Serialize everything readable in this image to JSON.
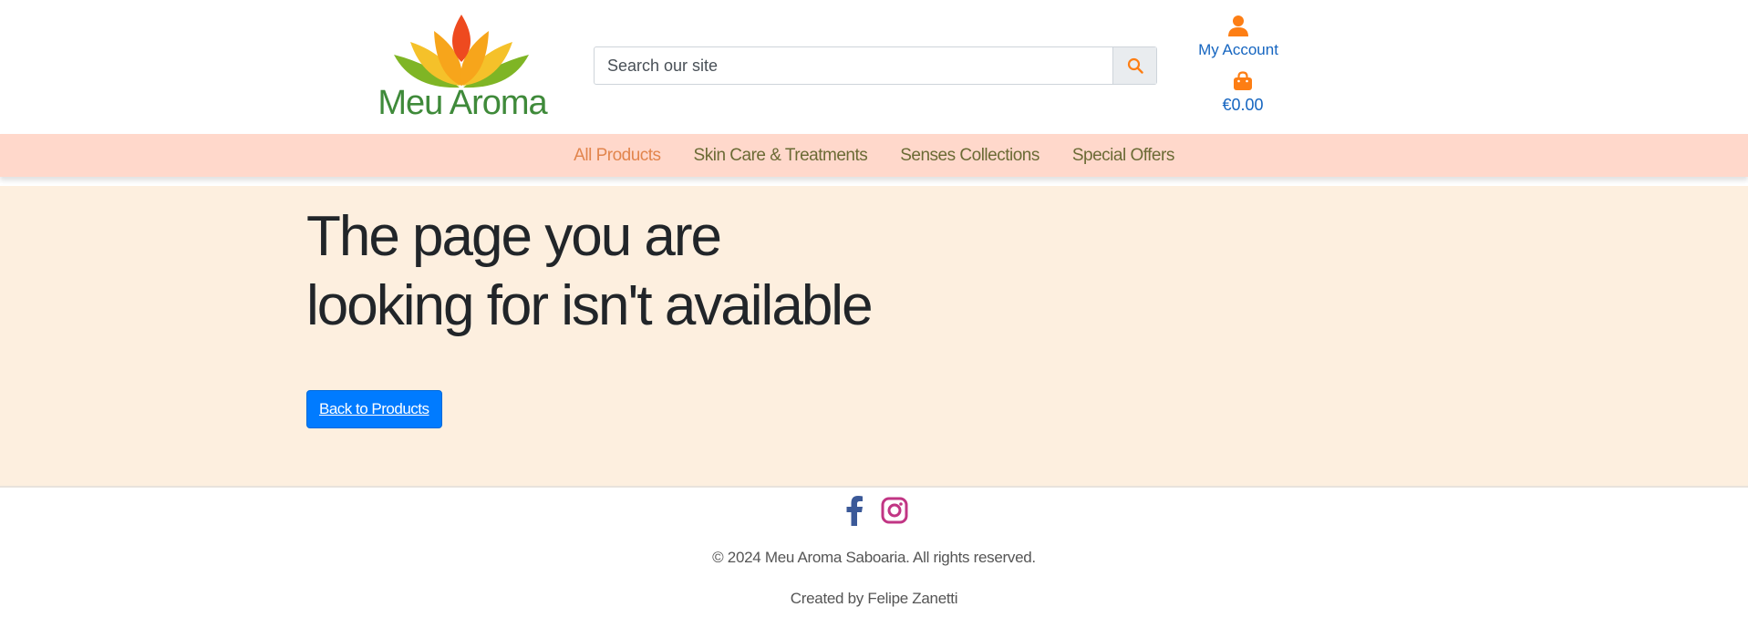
{
  "brand": {
    "logo_text": "Meu Aroma"
  },
  "search": {
    "placeholder": "Search our site"
  },
  "account": {
    "label": "My Account"
  },
  "cart": {
    "total": "€0.00"
  },
  "nav": {
    "items": [
      {
        "label": "All Products",
        "active": true
      },
      {
        "label": "Skin Care & Treatments"
      },
      {
        "label": "Senses Collections"
      },
      {
        "label": "Special Offers"
      }
    ]
  },
  "main": {
    "heading": "The page you are looking for isn't available",
    "back_button": "Back to Products"
  },
  "footer": {
    "social": [
      "facebook-icon",
      "instagram-icon"
    ],
    "copyright": "© 2024 Meu Aroma Saboaria. All rights reserved.",
    "credits": "Created by Felipe Zanetti"
  },
  "colors": {
    "accent_orange": "#fd7e14",
    "link_blue": "#1565c0",
    "nav_bg": "#ffd8cb",
    "main_bg": "#fdefdf",
    "button_blue": "#007bff",
    "facebook": "#3b5998",
    "instagram": "#c13584"
  }
}
